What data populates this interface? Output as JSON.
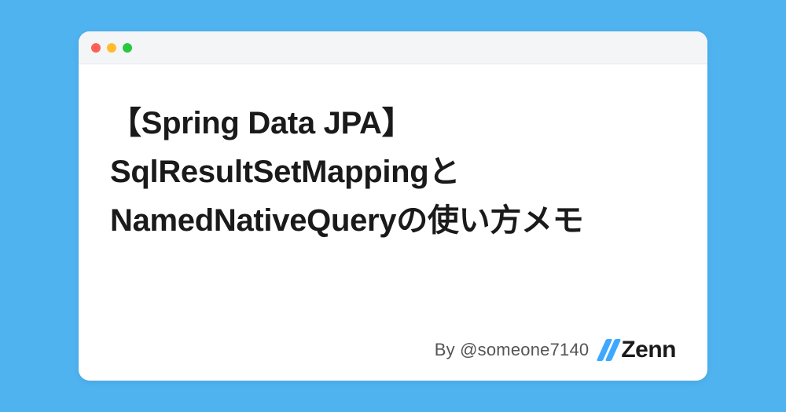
{
  "card": {
    "title": "【Spring Data JPA】SqlResultSetMappingとNamedNativeQueryの使い方メモ",
    "byline": "By @someone7140"
  },
  "logo": {
    "text": "Zenn"
  }
}
